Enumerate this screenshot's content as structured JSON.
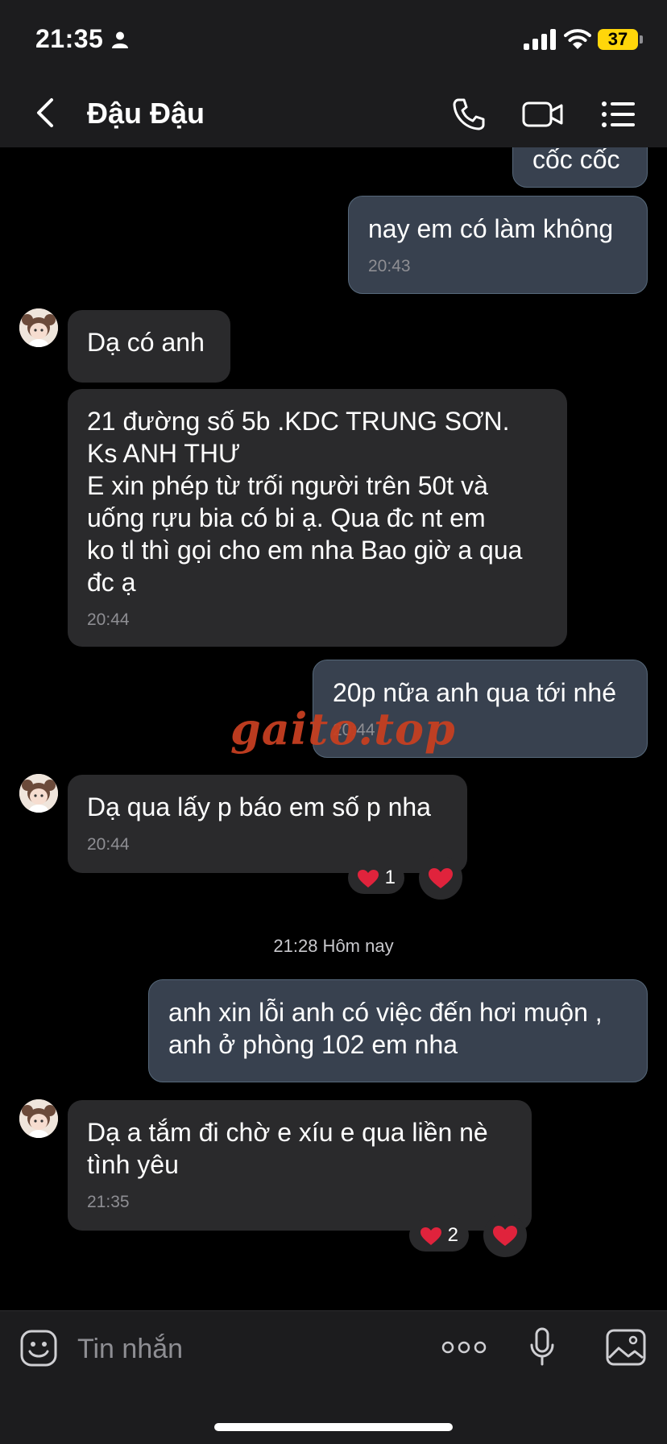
{
  "status_bar": {
    "time": "21:35",
    "battery": "37"
  },
  "header": {
    "contact_name": "Đậu Đậu"
  },
  "messages": [
    {
      "side": "out",
      "text": "cốc cốc"
    },
    {
      "side": "out",
      "text": "nay em có làm không",
      "time": "20:43"
    },
    {
      "side": "in",
      "text": "Dạ có anh"
    },
    {
      "side": "in",
      "text": "21 đường số 5b .KDC TRUNG SƠN.\nKs ANH THƯ\nE xin phép từ trối người trên 50t và\nuống rựu bia  có bi ạ. Qua đc nt em\nko tl thì gọi cho em nha Bao giờ a qua\nđc ạ",
      "time": "20:44"
    },
    {
      "side": "out",
      "text": "20p nữa anh qua tới nhé",
      "time": "20:44"
    },
    {
      "side": "in",
      "text": "Dạ qua lấy p báo em số p nha",
      "time": "20:44",
      "reaction_count": "1"
    },
    {
      "side": "out",
      "text": "anh xin lỗi anh có việc đến hơi muộn ,\nanh ở phòng 102 em nha"
    },
    {
      "side": "in",
      "text": "Dạ a tắm đi chờ e xíu e qua liền nè\ntình yêu",
      "time": "21:35",
      "reaction_count": "2"
    }
  ],
  "divider": {
    "label": "21:28 Hôm nay"
  },
  "watermark": "gaito.top",
  "input": {
    "placeholder": "Tin nhắn"
  },
  "colors": {
    "outgoing_bubble": "#38414f",
    "incoming_bubble": "#2a2a2c",
    "heart": "#e0233c",
    "watermark": "#c63f21"
  }
}
